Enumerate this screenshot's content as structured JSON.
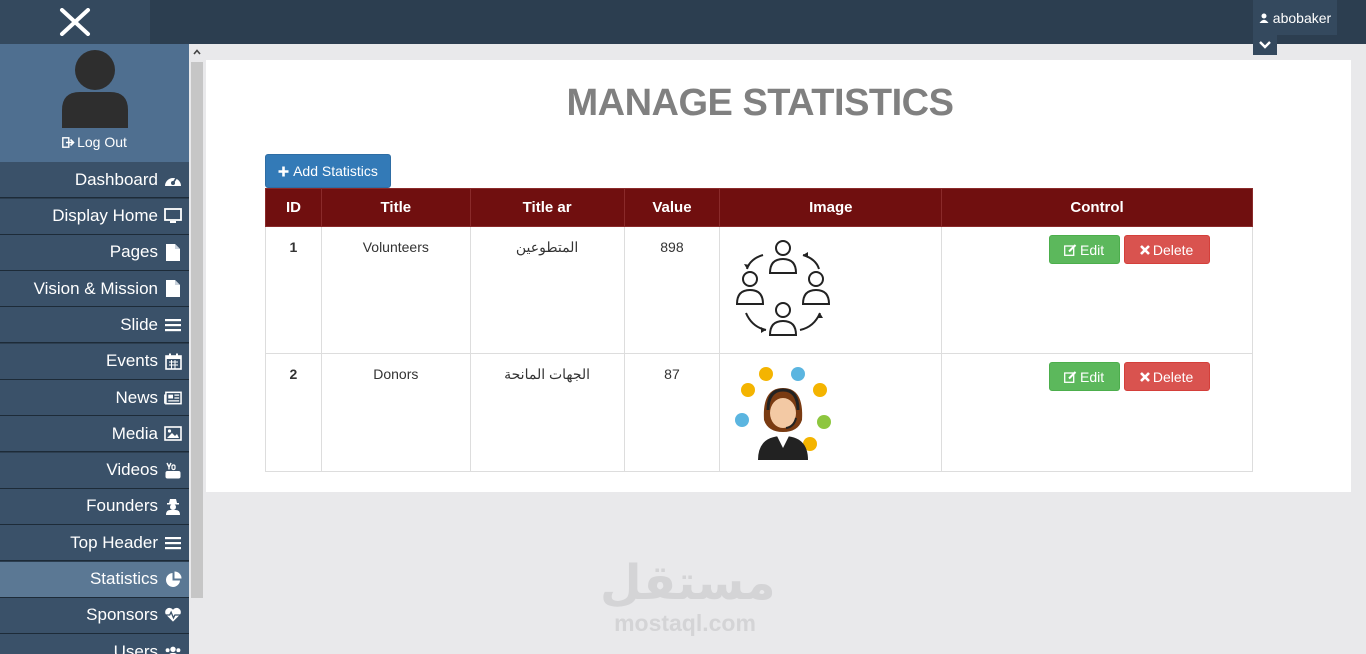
{
  "header": {
    "username": "abobaker"
  },
  "sidebar": {
    "logout_label": "Log Out",
    "items": [
      {
        "label": "Dashboard",
        "icon": "dashboard-icon"
      },
      {
        "label": "Display Home",
        "icon": "desktop-icon"
      },
      {
        "label": "Pages",
        "icon": "file-icon"
      },
      {
        "label": "Vision & Mission",
        "icon": "file-icon"
      },
      {
        "label": "Slide",
        "icon": "bars-icon"
      },
      {
        "label": "Events",
        "icon": "calendar-icon"
      },
      {
        "label": "News",
        "icon": "newspaper-icon"
      },
      {
        "label": "Media",
        "icon": "image-icon"
      },
      {
        "label": "Videos",
        "icon": "youtube-icon"
      },
      {
        "label": "Founders",
        "icon": "user-secret-icon"
      },
      {
        "label": "Top Header",
        "icon": "bars-icon"
      },
      {
        "label": "Statistics",
        "icon": "pie-chart-icon",
        "active": true
      },
      {
        "label": "Sponsors",
        "icon": "heartbeat-icon"
      },
      {
        "label": "Users",
        "icon": "users-icon"
      }
    ]
  },
  "main": {
    "title": "MANAGE STATISTICS",
    "add_button": "Add Statistics",
    "table": {
      "headers": [
        "ID",
        "Title",
        "Title ar",
        "Value",
        "Image",
        "Control"
      ],
      "rows": [
        {
          "id": "1",
          "title": "Volunteers",
          "title_ar": "المتطوعين",
          "value": "898",
          "image": "volunteers-network-image"
        },
        {
          "id": "2",
          "title": "Donors",
          "title_ar": "الجهات المانحة",
          "value": "87",
          "image": "support-agent-image"
        }
      ],
      "edit_label": "Edit",
      "delete_label": "Delete"
    }
  },
  "watermark": {
    "arabic": "مستقل",
    "latin": "mostaql.com"
  },
  "colors": {
    "topbar": "#2c3e50",
    "sidebar_item": "#3a5169",
    "sidebar_active": "#5b7894",
    "table_header": "#700f0f",
    "primary": "#337ab7",
    "success": "#5cb85c",
    "danger": "#d9534f"
  }
}
